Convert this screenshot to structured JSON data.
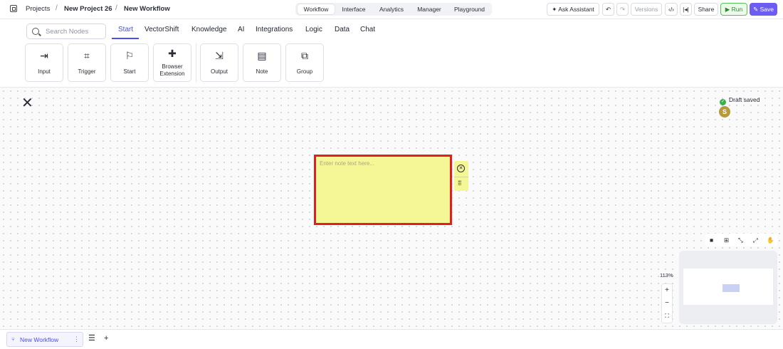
{
  "header": {
    "breadcrumb": [
      "Projects",
      "New Project 26",
      "New Workflow"
    ],
    "separator": "/",
    "tabs": [
      "Workflow",
      "Interface",
      "Analytics",
      "Manager",
      "Playground"
    ],
    "active_tab": "Workflow",
    "ask_assistant": "Ask Assistant",
    "versions": "Versions",
    "share": "Share",
    "run": "Run",
    "save": "Save",
    "accent_color": "#6d5cf2",
    "run_color": "#55c25a"
  },
  "toolbar": {
    "search_placeholder": "Search Nodes",
    "categories": [
      "Start",
      "VectorShift",
      "Knowledge",
      "AI",
      "Integrations",
      "Logic",
      "Data",
      "Chat"
    ],
    "active_category": "Start",
    "nodes": [
      {
        "label": "Input",
        "icon": "input-icon"
      },
      {
        "label": "Trigger",
        "icon": "crop-icon"
      },
      {
        "label": "Start",
        "icon": "flag-icon"
      },
      {
        "label": "Browser Extension",
        "icon": "puzzle-icon"
      },
      {
        "label": "Output",
        "icon": "output-icon"
      },
      {
        "label": "Note",
        "icon": "note-icon"
      },
      {
        "label": "Group",
        "icon": "group-icon"
      }
    ]
  },
  "canvas": {
    "status": "Draft saved",
    "avatar_initial": "S",
    "note_placeholder": "Enter note text here...",
    "note_color": "#f5f796",
    "highlight_color": "#e21f1f",
    "zoom": "113%"
  },
  "footer": {
    "workflow_tab": "New Workflow"
  }
}
